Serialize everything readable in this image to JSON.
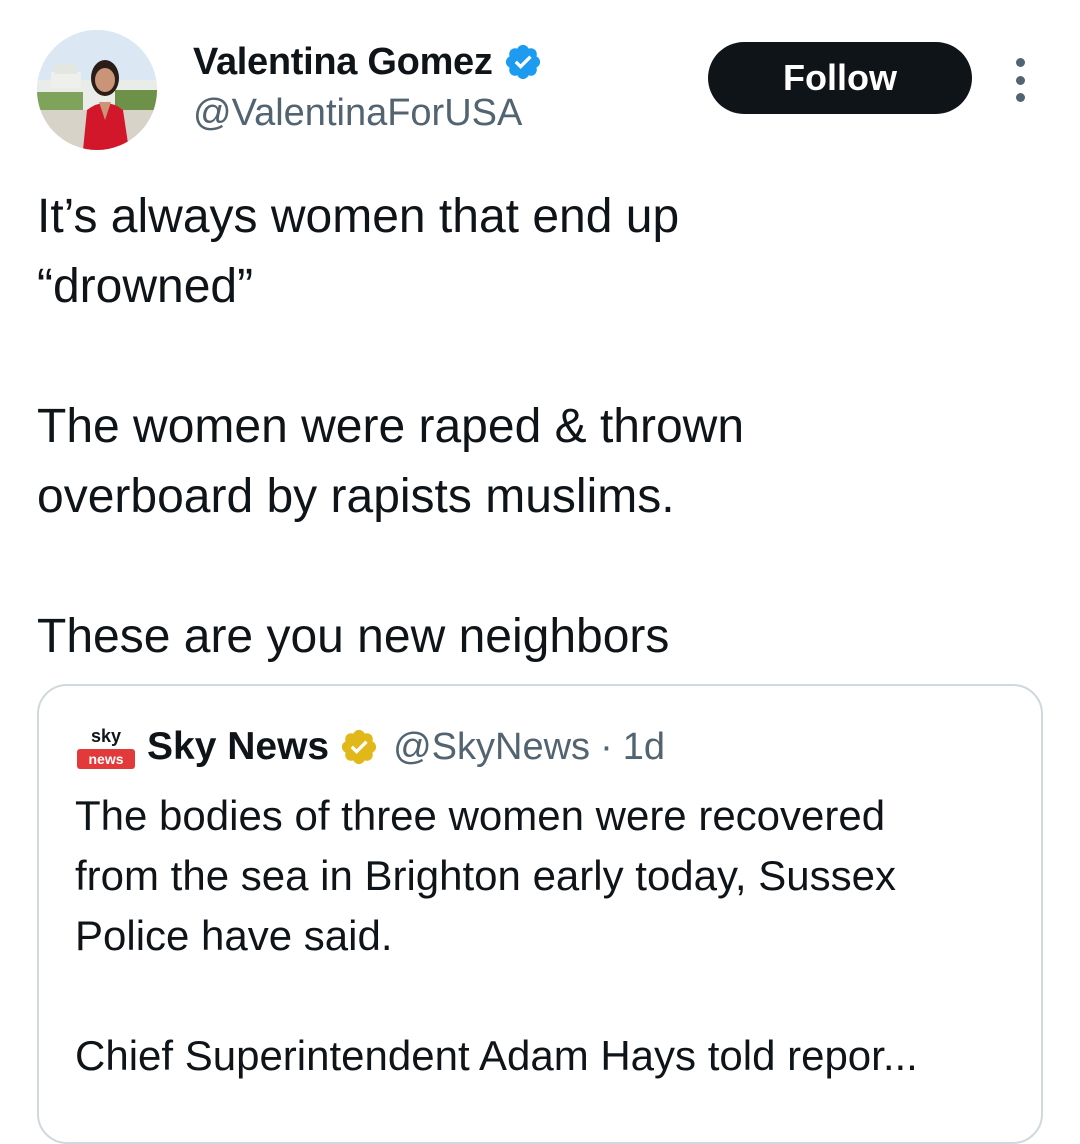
{
  "author": {
    "display_name": "Valentina Gomez",
    "handle": "@ValentinaForUSA",
    "verified_color": "#1d9bf0",
    "avatar_icon": "profile-photo"
  },
  "actions": {
    "follow_label": "Follow",
    "more_icon": "more-options-icon"
  },
  "tweet": {
    "text": "It’s always women that end up\n“drowned”\n\nThe women were raped & thrown\noverboard by rapists muslims.\n\nThese are you new neighbors"
  },
  "quoted_tweet": {
    "logo_icon": "sky-news-logo",
    "logo_text_top": "sky",
    "logo_text_bottom": "news",
    "display_name": "Sky News",
    "verified_color": "#e2b719",
    "handle": "@SkyNews",
    "separator": "·",
    "time": "1d",
    "text": "The bodies of three women were recovered\nfrom the sea in Brighton early today, Sussex\nPolice have said.\n\nChief Superintendent Adam Hays told repor..."
  }
}
